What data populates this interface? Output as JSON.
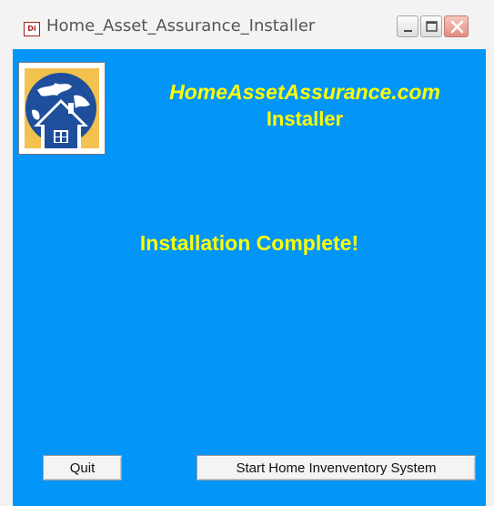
{
  "window": {
    "title": "Home_Asset_Assurance_Installer",
    "app_icon_text": "Di"
  },
  "header": {
    "site_name": "HomeAssetAssurance.com",
    "subtitle": "Installer"
  },
  "main": {
    "status": "Installation Complete!"
  },
  "buttons": {
    "quit": "Quit",
    "start": "Start Home Invenventory System"
  },
  "colors": {
    "background": "#0495f9",
    "heading_text": "#ffff00",
    "logo_globe": "#1f4f9c",
    "logo_sun": "#f2c14e"
  },
  "icons": {
    "app": "app-icon",
    "minimize": "minimize-icon",
    "maximize": "maximize-icon",
    "close": "close-icon",
    "logo": "globe-house-logo"
  }
}
